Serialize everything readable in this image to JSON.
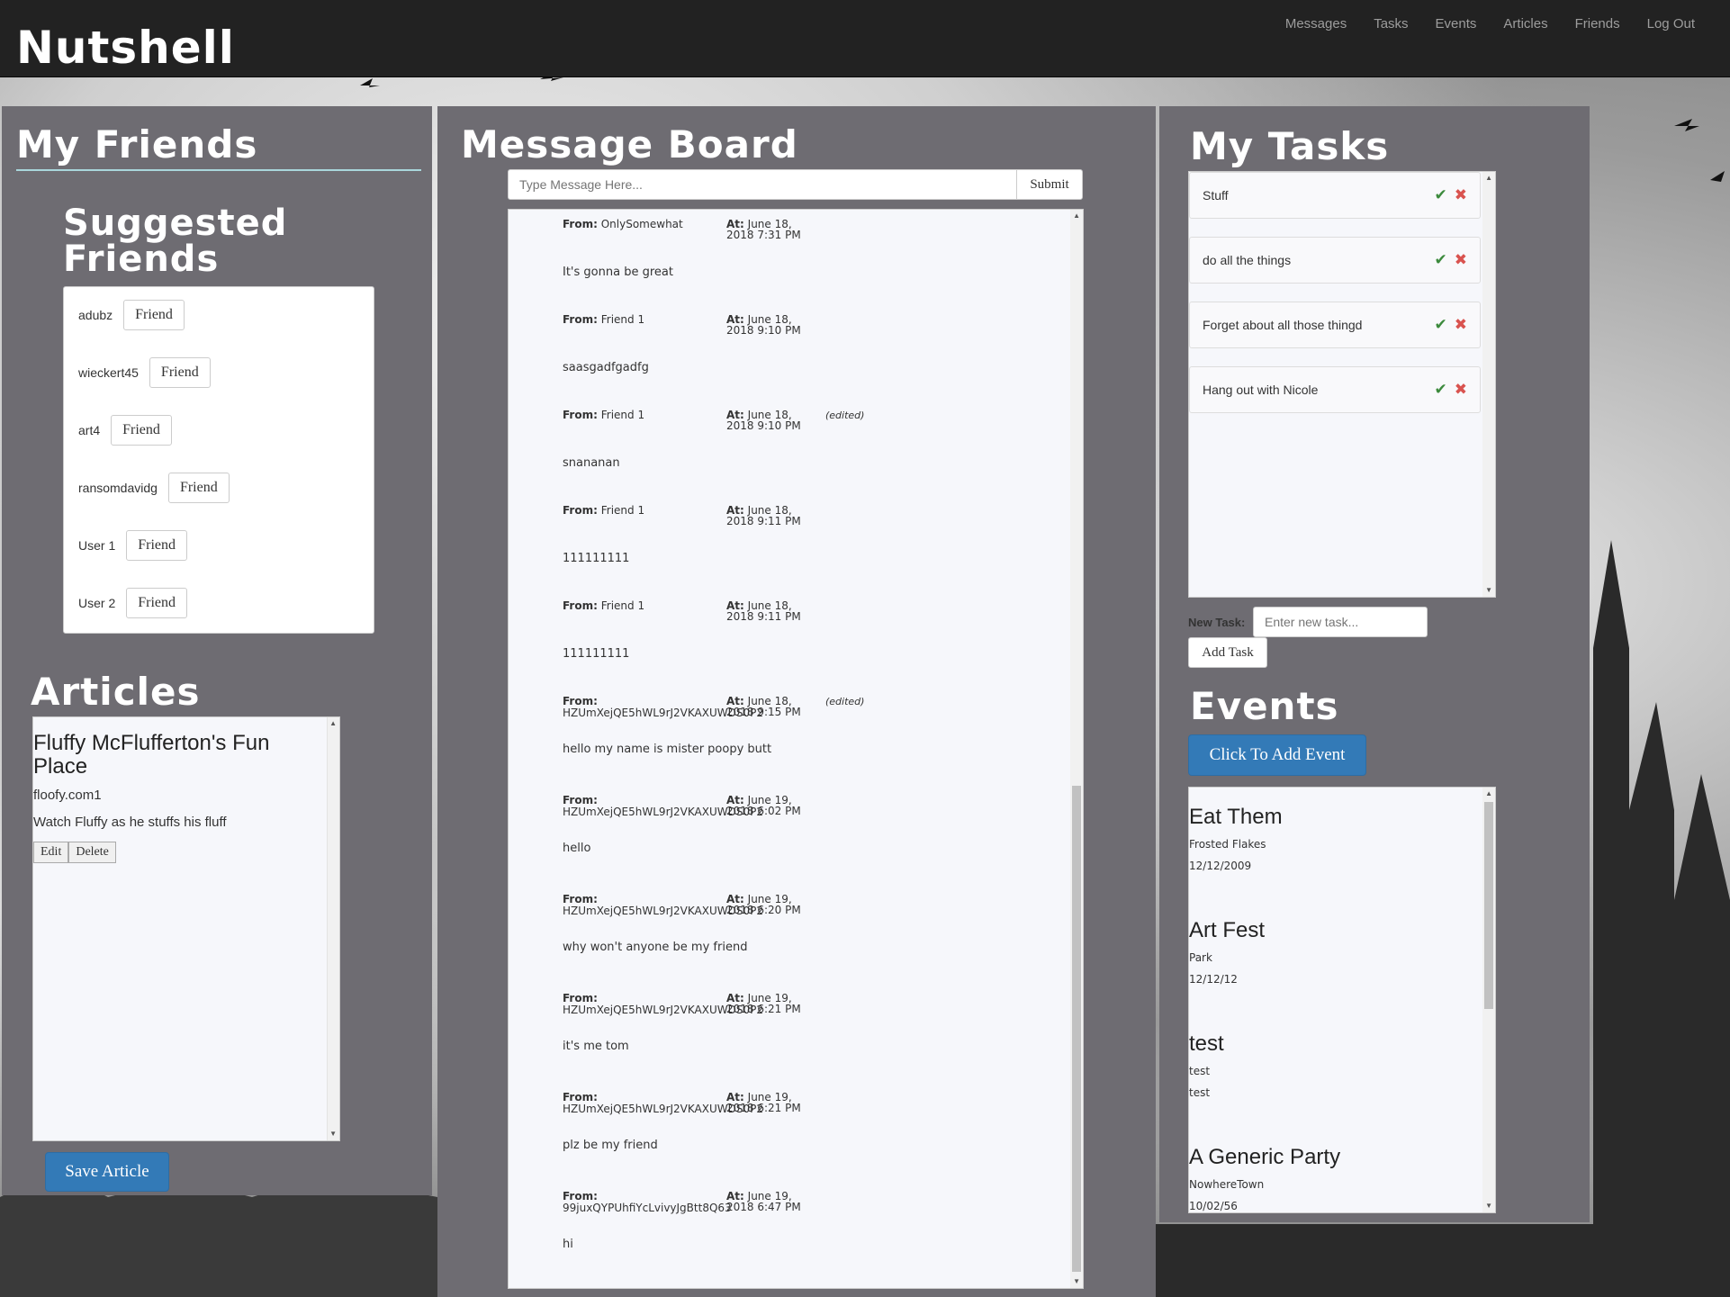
{
  "app": {
    "brand": "Nutshell",
    "nav": [
      "Messages",
      "Tasks",
      "Events",
      "Articles",
      "Friends",
      "Log Out"
    ]
  },
  "friends": {
    "title": "My Friends",
    "suggested_title": "Suggested Friends",
    "button_label": "Friend",
    "suggested": [
      "adubz",
      "wieckert45",
      "art4",
      "ransomdavidg",
      "User 1",
      "User 2"
    ]
  },
  "articles": {
    "title": "Articles",
    "items": [
      {
        "title": "Fluffy McFlufferton's Fun Place",
        "url": "floofy.com1",
        "description": "Watch Fluffy as he stuffs his fluff",
        "edit_label": "Edit",
        "delete_label": "Delete"
      }
    ],
    "save_label": "Save Article"
  },
  "messages": {
    "title": "Message Board",
    "input_placeholder": "Type Message Here...",
    "submit_label": "Submit",
    "from_label": "From:",
    "at_label": "At:",
    "items": [
      {
        "from": "OnlySomewhat",
        "at": "June 18, 2018 7:31 PM",
        "edited": "",
        "body": "It's gonna be great"
      },
      {
        "from": "Friend 1",
        "at": "June 18, 2018 9:10 PM",
        "edited": "",
        "body": "saasgadfgadfg"
      },
      {
        "from": "Friend 1",
        "at": "June 18, 2018 9:10 PM",
        "edited": "(edited)",
        "body": "snananan"
      },
      {
        "from": "Friend 1",
        "at": "June 18, 2018 9:11 PM",
        "edited": "",
        "body": "111111111"
      },
      {
        "from": "Friend 1",
        "at": "June 18, 2018 9:11 PM",
        "edited": "",
        "body": "111111111"
      },
      {
        "from": "HZUmXejQE5hWL9rJ2VKAXUWDS0P2",
        "at": "June 18, 2018 9:15 PM",
        "edited": "(edited)",
        "body": "hello my name is mister poopy butt"
      },
      {
        "from": "HZUmXejQE5hWL9rJ2VKAXUWDS0P2",
        "at": "June 19, 2018 6:02 PM",
        "edited": "",
        "body": "hello"
      },
      {
        "from": "HZUmXejQE5hWL9rJ2VKAXUWDS0P2",
        "at": "June 19, 2018 6:20 PM",
        "edited": "",
        "body": "why won't anyone be my friend"
      },
      {
        "from": "HZUmXejQE5hWL9rJ2VKAXUWDS0P2",
        "at": "June 19, 2018 6:21 PM",
        "edited": "",
        "body": "it's me tom"
      },
      {
        "from": "HZUmXejQE5hWL9rJ2VKAXUWDS0P2",
        "at": "June 19, 2018 6:21 PM",
        "edited": "",
        "body": "plz be my friend"
      },
      {
        "from": "99juxQYPUhfiYcLvivyJgBtt8Q63",
        "at": "June 19, 2018 6:47 PM",
        "edited": "",
        "body": "hi"
      }
    ]
  },
  "tasks": {
    "title": "My Tasks",
    "items": [
      "Stuff",
      "do all the things",
      "Forget about all those thingd",
      "Hang out with Nicole"
    ],
    "new_task_label": "New Task:",
    "new_task_placeholder": "Enter new task...",
    "add_label": "Add Task"
  },
  "events": {
    "title": "Events",
    "add_label": "Click To Add Event",
    "items": [
      {
        "name": "Eat Them",
        "location": "Frosted Flakes",
        "date": "12/12/2009"
      },
      {
        "name": "Art Fest",
        "location": "Park",
        "date": "12/12/12"
      },
      {
        "name": "test",
        "location": "test",
        "date": "test"
      },
      {
        "name": "A Generic Party",
        "location": "NowhereTown",
        "date": "10/02/56"
      }
    ]
  },
  "colors": {
    "panel": "#6e6c72",
    "navbar": "#222222",
    "primary_button": "#337ab7",
    "check": "#3c8a3c",
    "delete": "#d9534f"
  },
  "icons": {
    "task_complete": "check-icon",
    "task_delete": "close-icon"
  }
}
